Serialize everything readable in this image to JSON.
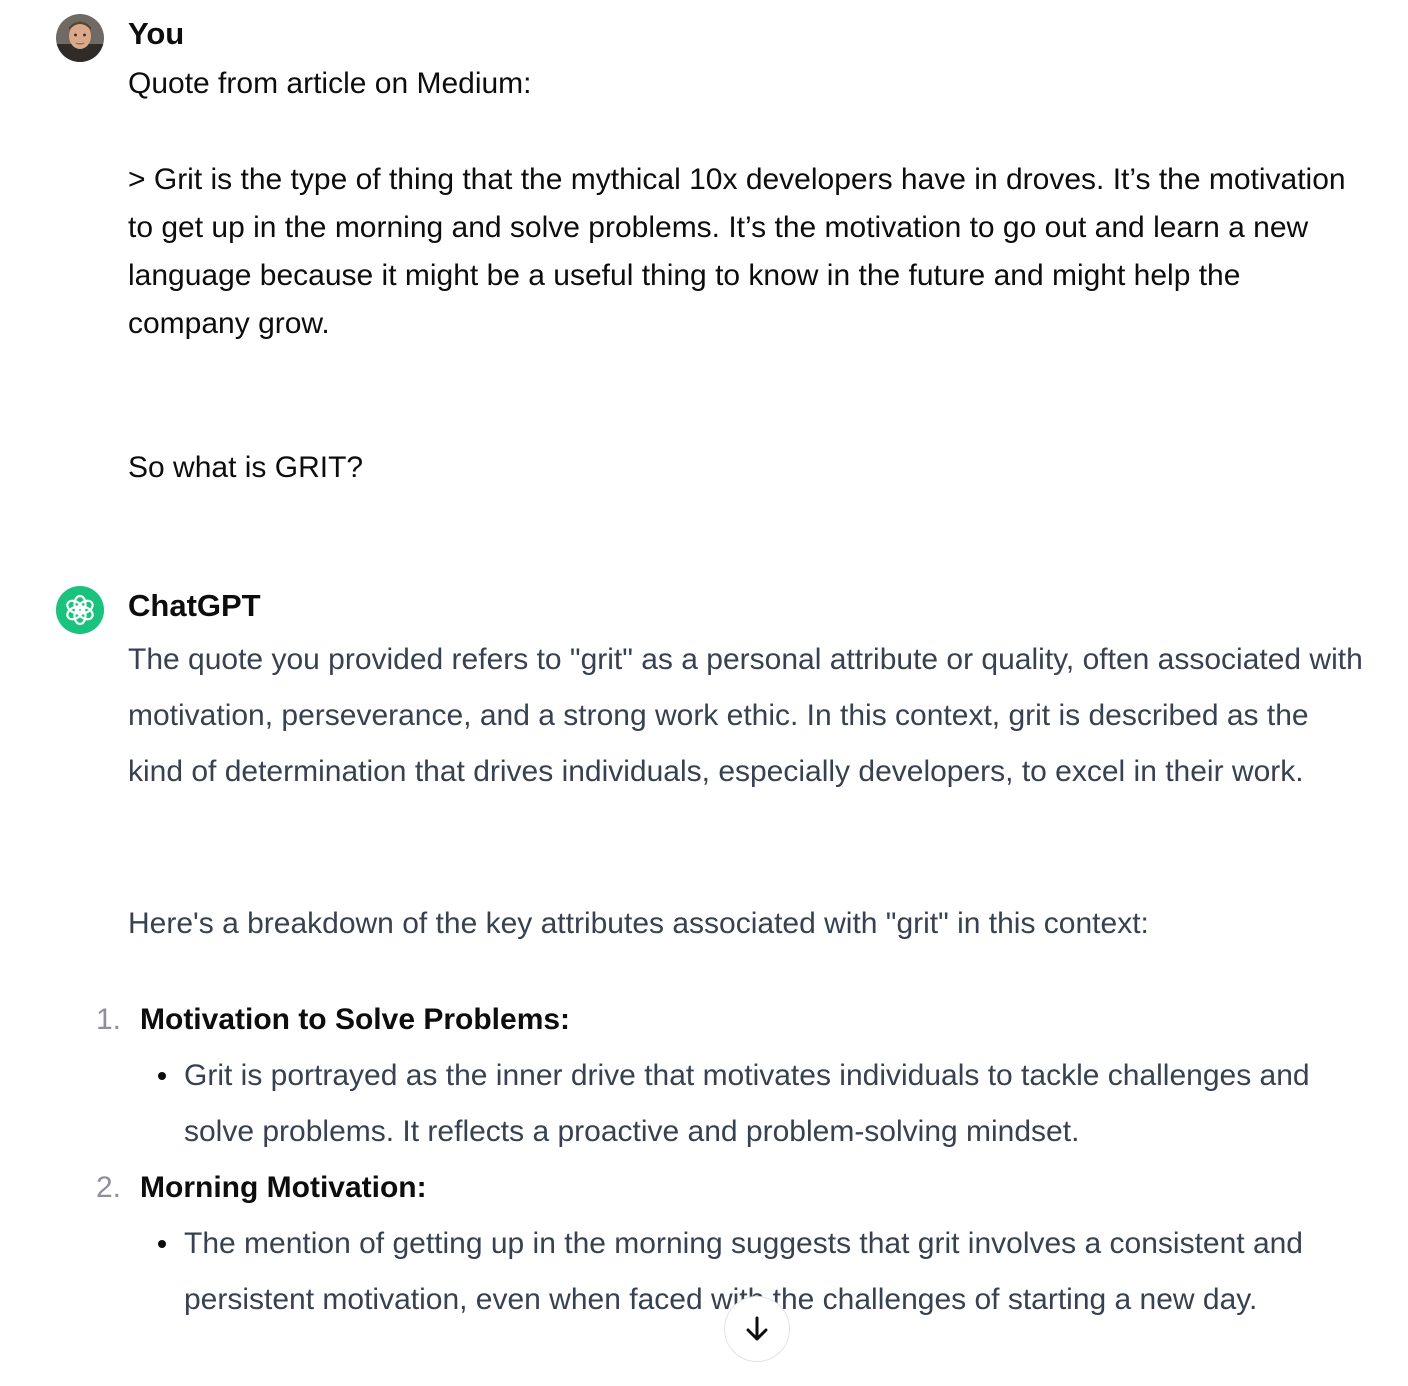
{
  "conversation": {
    "user_message": {
      "author": "You",
      "lines": [
        "Quote from article on Medium:",
        "",
        "> Grit is the type of thing that the mythical 10x developers have in droves. It’s the motivation to get up in the morning and solve problems. It’s the motivation to go out and learn a new language because it might be a useful thing to know in the future and might help the company grow.",
        "",
        "",
        "So what is GRIT?"
      ]
    },
    "assistant_message": {
      "author": "ChatGPT",
      "intro": "The quote you provided refers to \"grit\" as a personal attribute or quality, often associated with motivation, perseverance, and a strong work ethic. In this context, grit is described as the kind of determination that drives individuals, especially developers, to excel in their work.",
      "breakdown_intro": "Here's a breakdown of the key attributes associated with \"grit\" in this context:",
      "items": [
        {
          "number": "1.",
          "heading": "Motivation to Solve Problems:",
          "bullet": "Grit is portrayed as the inner drive that motivates individuals to tackle challenges and solve problems. It reflects a proactive and problem-solving mindset."
        },
        {
          "number": "2.",
          "heading": "Morning Motivation:",
          "bullet": "The mention of getting up in the morning suggests that grit involves a consistent and persistent motivation, even when faced with the challenges of starting a new day."
        }
      ]
    }
  },
  "icons": {
    "scroll_down": "arrow-down-icon",
    "assistant_avatar": "openai-logo-icon"
  },
  "colors": {
    "assistant_avatar_bg": "#19c37d",
    "body_text": "#374151",
    "heading_text": "#0d0d0d"
  }
}
